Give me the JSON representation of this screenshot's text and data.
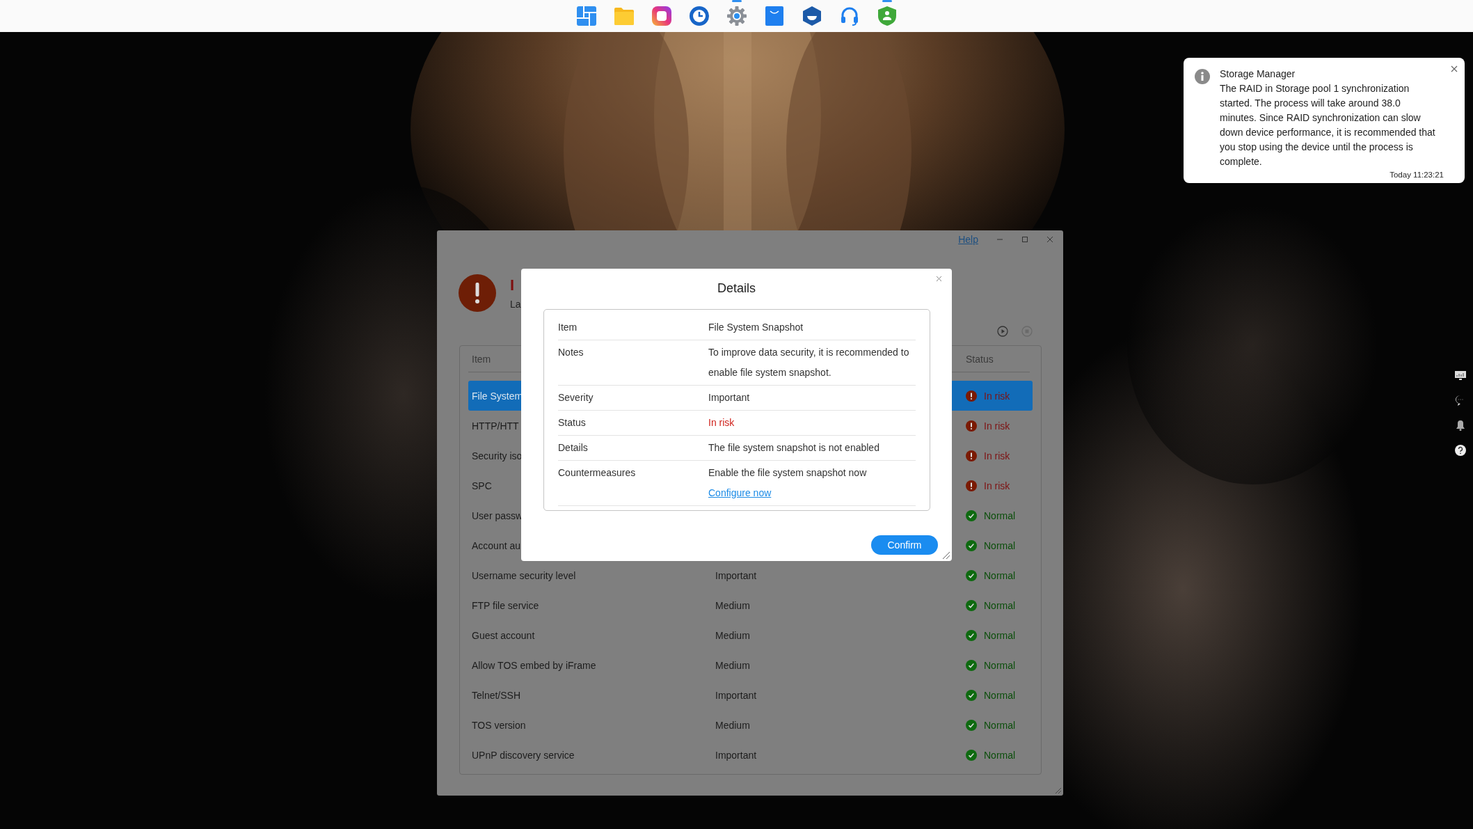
{
  "taskbar": [
    {
      "running": false
    },
    {
      "running": false
    },
    {
      "running": false
    },
    {
      "running": false
    },
    {
      "running": true
    },
    {
      "running": false
    },
    {
      "running": false
    },
    {
      "running": false
    },
    {
      "running": true
    }
  ],
  "notification": {
    "title": "Storage Manager",
    "message": "The RAID in Storage pool 1 synchronization started. The process will take around 38.0 minutes. Since RAID synchronization can slow down device performance, it is recommended that you stop using the device until the process is complete.",
    "time": "Today 11:23:21"
  },
  "window": {
    "help": "Help",
    "heading": "I",
    "subheading": "La",
    "table": {
      "columns": [
        "Item",
        "Status"
      ],
      "rows": [
        {
          "item": "File System",
          "status": "In risk",
          "kind": "risk",
          "selected": true
        },
        {
          "item": "HTTP/HTT",
          "status": "In risk",
          "kind": "risk",
          "selected": false
        },
        {
          "item": "Security iso",
          "status": "In risk",
          "kind": "risk",
          "selected": false
        },
        {
          "item": "SPC",
          "status": "In risk",
          "kind": "risk",
          "selected": false
        },
        {
          "item": "User passw",
          "status": "Normal",
          "kind": "normal",
          "selected": false
        },
        {
          "item": "Account au",
          "status": "Normal",
          "kind": "normal",
          "selected": false
        },
        {
          "item": "Username security level",
          "severity": "Important",
          "status": "Normal",
          "kind": "normal",
          "selected": false
        },
        {
          "item": "FTP file service",
          "severity": "Medium",
          "status": "Normal",
          "kind": "normal",
          "selected": false
        },
        {
          "item": "Guest account",
          "severity": "Medium",
          "status": "Normal",
          "kind": "normal",
          "selected": false
        },
        {
          "item": "Allow TOS embed by iFrame",
          "severity": "Medium",
          "status": "Normal",
          "kind": "normal",
          "selected": false
        },
        {
          "item": "Telnet/SSH",
          "severity": "Important",
          "status": "Normal",
          "kind": "normal",
          "selected": false
        },
        {
          "item": "TOS version",
          "severity": "Medium",
          "status": "Normal",
          "kind": "normal",
          "selected": false
        },
        {
          "item": "UPnP discovery service",
          "severity": "Important",
          "status": "Normal",
          "kind": "normal",
          "selected": false
        }
      ]
    }
  },
  "dialog": {
    "title": "Details",
    "rows": [
      {
        "label": "Item",
        "value": "File System Snapshot",
        "kind": "text"
      },
      {
        "label": "Notes",
        "value": "To improve data security, it is recommended to enable file system snapshot.",
        "kind": "text"
      },
      {
        "label": "Severity",
        "value": "Important",
        "kind": "text"
      },
      {
        "label": "Status",
        "value": "In risk",
        "kind": "alert"
      },
      {
        "label": "Details",
        "value": "The file system snapshot is not enabled",
        "kind": "text"
      },
      {
        "label": "Countermeasures",
        "value": "Enable the file system snapshot now",
        "link": "Configure now",
        "kind": "link"
      }
    ],
    "confirm": "Confirm"
  }
}
